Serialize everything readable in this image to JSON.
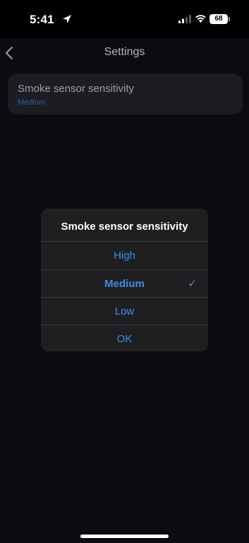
{
  "status_bar": {
    "time": "5:41",
    "battery": "68"
  },
  "nav": {
    "title": "Settings"
  },
  "setting": {
    "label": "Smoke sensor sensitivity",
    "value": "Medium"
  },
  "dialog": {
    "title": "Smoke sensor sensitivity",
    "options": [
      {
        "label": "High"
      },
      {
        "label": "Medium",
        "selected": true
      },
      {
        "label": "Low"
      }
    ],
    "ok_label": "OK",
    "check": "✓"
  },
  "colors": {
    "accent": "#3b8eea",
    "secondary_text": "#2d5f9d",
    "dialog_bg": "#1f1f22"
  }
}
